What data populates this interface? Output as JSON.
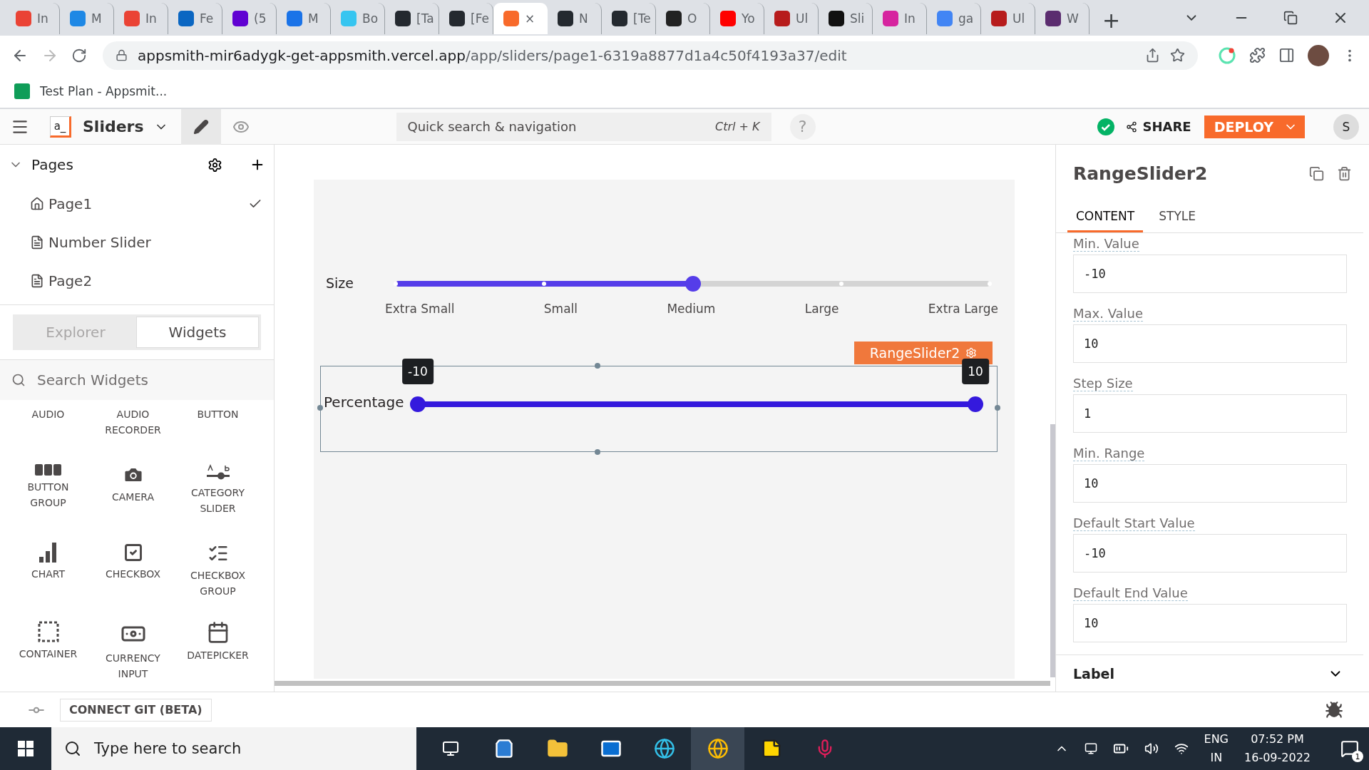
{
  "browser": {
    "tabs": [
      {
        "label": "In",
        "selected": false,
        "color": "#ea4335"
      },
      {
        "label": "M",
        "selected": false,
        "color": "#1e88e5"
      },
      {
        "label": "In",
        "selected": false,
        "color": "#ea4335"
      },
      {
        "label": "Fe",
        "selected": false,
        "color": "#0a66c2"
      },
      {
        "label": "(5",
        "selected": false,
        "color": "#6001d2"
      },
      {
        "label": "M",
        "selected": false,
        "color": "#1a73e8"
      },
      {
        "label": "Bo",
        "selected": false,
        "color": "#36c5f0"
      },
      {
        "label": "[Ta",
        "selected": false,
        "color": "#24292f"
      },
      {
        "label": "[Fe",
        "selected": false,
        "color": "#24292f"
      },
      {
        "label": "×",
        "selected": true,
        "color": "#f86a2b"
      },
      {
        "label": "N",
        "selected": false,
        "color": "#24292f"
      },
      {
        "label": "[Te",
        "selected": false,
        "color": "#24292f"
      },
      {
        "label": "O",
        "selected": false,
        "color": "#222222"
      },
      {
        "label": "Yo",
        "selected": false,
        "color": "#ff0000"
      },
      {
        "label": "Ul",
        "selected": false,
        "color": "#b71c1c"
      },
      {
        "label": "Sli",
        "selected": false,
        "color": "#111111"
      },
      {
        "label": "In",
        "selected": false,
        "color": "#d6249f"
      },
      {
        "label": "ga",
        "selected": false,
        "color": "#4285f4"
      },
      {
        "label": "Ul",
        "selected": false,
        "color": "#b71c1c"
      },
      {
        "label": "W",
        "selected": false,
        "color": "#5b2c6f"
      }
    ],
    "new_tab": "+",
    "address": {
      "host": "appsmith-mir6adygk-get-appsmith.vercel.app",
      "path": "/app/sliders/page1-6319a8877d1a4c50f4193a37/edit"
    },
    "bookmarks": [
      {
        "label": "Test Plan - Appsmit..."
      }
    ]
  },
  "header": {
    "logo": "a_",
    "app_name": "Sliders",
    "search": {
      "placeholder": "Quick search & navigation",
      "shortcut": "Ctrl + K"
    },
    "help": "?",
    "share": "SHARE",
    "deploy": "DEPLOY",
    "avatar": "S"
  },
  "pages": {
    "title": "Pages",
    "items": [
      {
        "label": "Page1",
        "kind": "home",
        "selected": true
      },
      {
        "label": "Number Slider",
        "kind": "page",
        "selected": false
      },
      {
        "label": "Page2",
        "kind": "page",
        "selected": false
      }
    ]
  },
  "sidebar_tabs": [
    {
      "label": "Explorer",
      "selected": false
    },
    {
      "label": "Widgets",
      "selected": true
    }
  ],
  "widget_search": {
    "placeholder": "Search Widgets"
  },
  "widgets": [
    {
      "label": "AUDIO"
    },
    {
      "label": "AUDIO RECORDER"
    },
    {
      "label": "BUTTON"
    },
    {
      "label": "BUTTON GROUP",
      "kind": "button-group"
    },
    {
      "label": "CAMERA",
      "kind": "camera"
    },
    {
      "label": "CATEGORY SLIDER",
      "kind": "category-slider"
    },
    {
      "label": "CHART",
      "kind": "chart"
    },
    {
      "label": "CHECKBOX",
      "kind": "checkbox"
    },
    {
      "label": "CHECKBOX GROUP",
      "kind": "checkbox-group"
    },
    {
      "label": "CONTAINER",
      "kind": "container"
    },
    {
      "label": "CURRENCY INPUT",
      "kind": "currency"
    },
    {
      "label": "DATEPICKER",
      "kind": "datepicker"
    }
  ],
  "canvas": {
    "category_slider": {
      "label": "Size",
      "level": 0.5,
      "options": [
        "Extra Small",
        "Small",
        "Medium",
        "Large",
        "Extra Large"
      ]
    },
    "range_slider": {
      "name": "RangeSlider2",
      "label": "Percentage",
      "start": {
        "tooltip": "-10",
        "level": 0
      },
      "end": {
        "tooltip": "10",
        "level": 1
      }
    }
  },
  "properties": {
    "title": "RangeSlider2",
    "tabs": [
      {
        "label": "CONTENT",
        "selected": true
      },
      {
        "label": "STYLE",
        "selected": false
      }
    ],
    "fields": [
      {
        "label": "Min. Value",
        "value": "-10"
      },
      {
        "label": "Max. Value",
        "value": "10"
      },
      {
        "label": "Step Size",
        "value": "1"
      },
      {
        "label": "Min. Range",
        "value": "10"
      },
      {
        "label": "Default Start Value",
        "value": "-10"
      },
      {
        "label": "Default End Value",
        "value": "10"
      }
    ],
    "section": "Label"
  },
  "footer": {
    "git": "CONNECT GIT (BETA)"
  },
  "taskbar": {
    "search": {
      "placeholder": "Type here to search"
    },
    "lang": "ENG",
    "region": "IN",
    "time": "07:52 PM",
    "date": "16-09-2022",
    "notifications": "1"
  }
}
